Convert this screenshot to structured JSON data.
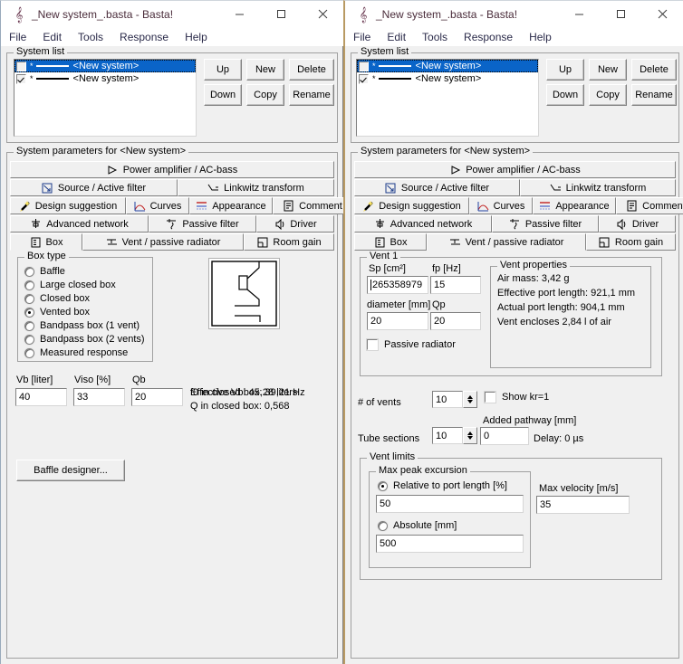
{
  "window": {
    "title": "_New system_.basta - Basta!",
    "icon": "music-note-icon",
    "buttons": {
      "minimize": "minimize-icon",
      "maximize": "maximize-icon",
      "close": "close-icon"
    }
  },
  "menu": {
    "items": [
      "File",
      "Edit",
      "Tools",
      "Response",
      "Help"
    ]
  },
  "system_list": {
    "legend": "System list",
    "rows": [
      {
        "checked": false,
        "star": "*",
        "label": "<New system>",
        "selected": true
      },
      {
        "checked": true,
        "star": "*",
        "label": "<New system>",
        "selected": false
      }
    ],
    "buttons": [
      "Up",
      "New",
      "Delete",
      "Down",
      "Copy",
      "Rename"
    ]
  },
  "system_params": {
    "legend": "System parameters for <New system>",
    "tabs": {
      "row1": [
        {
          "label": "Power amplifier / AC-bass",
          "icon": "play-triangle-icon",
          "active": false
        }
      ],
      "row2": [
        {
          "label": "Source / Active filter",
          "icon": "source-filter-icon",
          "active": false
        },
        {
          "label": "Linkwitz transform",
          "icon": "linkwitz-curve-icon",
          "active": false
        }
      ],
      "row3": [
        {
          "label": "Design suggestion",
          "icon": "magic-wand-icon",
          "active": false
        },
        {
          "label": "Curves",
          "icon": "curves-icon",
          "active": false
        },
        {
          "label": "Appearance",
          "icon": "appearance-icon",
          "active": false
        },
        {
          "label": "Comment",
          "icon": "comment-icon",
          "active": false
        }
      ],
      "row4": [
        {
          "label": "Advanced network",
          "icon": "network-icon",
          "active": false
        },
        {
          "label": "Passive filter",
          "icon": "passive-filter-icon",
          "active": false
        },
        {
          "label": "Driver",
          "icon": "speaker-icon",
          "active": false
        }
      ],
      "row5_left": [
        {
          "label": "Box",
          "icon": "box-icon",
          "active": true
        },
        {
          "label": "Vent / passive radiator",
          "icon": "vent-icon",
          "active": false
        },
        {
          "label": "Room gain",
          "icon": "room-gain-icon",
          "active": false
        }
      ],
      "row5_right": [
        {
          "label": "Box",
          "icon": "box-icon",
          "active": false
        },
        {
          "label": "Vent / passive radiator",
          "icon": "vent-icon",
          "active": true
        },
        {
          "label": "Room gain",
          "icon": "room-gain-icon",
          "active": false
        }
      ]
    }
  },
  "box_tab": {
    "box_type": {
      "legend": "Box type",
      "options": [
        {
          "label": "Baffle",
          "selected": false
        },
        {
          "label": "Large closed box",
          "selected": false
        },
        {
          "label": "Closed box",
          "selected": false
        },
        {
          "label": "Vented box",
          "selected": true
        },
        {
          "label": "Bandpass box (1 vent)",
          "selected": false
        },
        {
          "label": "Bandpass box (2 vents)",
          "selected": false
        },
        {
          "label": "Measured response",
          "selected": false
        }
      ]
    },
    "effective_vb": "Effective Vb: 45,28 liters",
    "fields": [
      {
        "label": "Vb [liter]",
        "value": "40"
      },
      {
        "label": "Viso [%]",
        "value": "33"
      },
      {
        "label": "Qb",
        "value": "20"
      }
    ],
    "f0_text": "f0 in closed box: 39,21 Hz",
    "q_text": "Q  in closed box: 0,568",
    "baffle_designer_button": "Baffle designer..."
  },
  "vent_tab": {
    "vent1": {
      "legend": "Vent 1",
      "sp_label": "Sp [cm²]",
      "sp_value": "265358979",
      "fp_label": "fp [Hz]",
      "fp_value": "15",
      "diameter_label": "diameter [mm]",
      "diameter_value": "20",
      "qp_label": "Qp",
      "qp_value": "20",
      "passive_radiator_label": "Passive radiator",
      "passive_radiator_checked": false,
      "properties": {
        "legend": "Vent properties",
        "lines": [
          "Air mass: 3,42 g",
          "Effective port length: 921,1 mm",
          "Actual port length: 904,1 mm",
          "Vent encloses 2,84 l of air"
        ]
      }
    },
    "num_vents_label": "# of vents",
    "num_vents_value": "10",
    "show_kr_label": "Show kr=1",
    "show_kr_checked": false,
    "tube_sections_label": "Tube sections",
    "tube_sections_value": "10",
    "added_pathway_label": "Added pathway [mm]",
    "added_pathway_value": "0",
    "delay_text": "Delay: 0 µs",
    "vent_limits": {
      "legend": "Vent limits",
      "max_peak": {
        "legend": "Max peak excursion",
        "relative_label": "Relative to port length [%]",
        "relative_selected": true,
        "relative_value": "50",
        "absolute_label": "Absolute [mm]",
        "absolute_selected": false,
        "absolute_value": "500"
      },
      "max_velocity_label": "Max velocity [m/s]",
      "max_velocity_value": "35"
    }
  },
  "colors": {
    "face": "#f0f0f0",
    "selection": "#0a64c8",
    "title_text": "#4a2c3a",
    "menu_text": "#2b2b4a",
    "border": "#a0a0a0",
    "right_window_edge": "#b99a63"
  }
}
